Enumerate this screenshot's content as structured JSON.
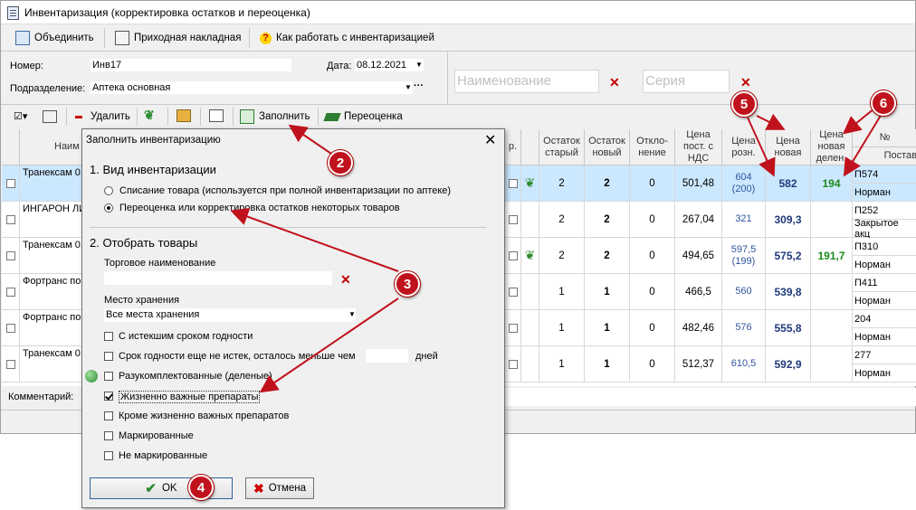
{
  "window": {
    "title": "Инвентаризация (корректировка остатков и переоценка)"
  },
  "toolbar": {
    "merge": "Объединить",
    "incoming": "Приходная накладная",
    "howto": "Как работать с инвентаризацией"
  },
  "header": {
    "number_label": "Номер:",
    "number_value": "Инв17",
    "date_label": "Дата:",
    "date_value": "08.12.2021",
    "dept_label": "Подразделение:",
    "dept_value": "Аптека основная",
    "name_placeholder": "Наименование",
    "series_placeholder": "Серия"
  },
  "toolbar2": {
    "delete": "Удалить",
    "fill": "Заполнить",
    "reprice": "Переоценка"
  },
  "grid": {
    "columns": {
      "name": "Наим",
      "pr": "р.",
      "old_stock": "Остаток старый",
      "new_stock": "Остаток новый",
      "deviation": "Откло-нение",
      "price_vat": "Цена пост. с НДС",
      "price_retail": "Цена розн.",
      "price_new": "Цена новая",
      "price_new_div": "Цена новая делен.",
      "no": "№",
      "supplier": "Постав"
    },
    "rows": [
      {
        "name": "Транексам 0,",
        "old": "2",
        "new": "2",
        "dev": "0",
        "vat": "501,48",
        "retail": "604",
        "retail2": "(200)",
        "pnew": "582",
        "pdiv": "194",
        "no": "П574",
        "sup": "Норман"
      },
      {
        "name": "ИНГАРОН ЛИ Р-РА ДЛЯ ИН ВВЕД. 100ТЫ",
        "old": "2",
        "new": "2",
        "dev": "0",
        "vat": "267,04",
        "retail": "321",
        "retail2": "",
        "pnew": "309,3",
        "pdiv": "",
        "no": "П252",
        "sup": "Закрытое акц"
      },
      {
        "name": "Транексам 0,",
        "old": "2",
        "new": "2",
        "dev": "0",
        "vat": "494,65",
        "retail": "597,5",
        "retail2": "(199)",
        "pnew": "575,2",
        "pdiv": "191,7",
        "no": "П310",
        "sup": "Норман"
      },
      {
        "name": "Фортранс пор пак.№4*",
        "old": "1",
        "new": "1",
        "dev": "0",
        "vat": "466,5",
        "retail": "560",
        "retail2": "",
        "pnew": "539,8",
        "pdiv": "",
        "no": "П411",
        "sup": "Норман"
      },
      {
        "name": "Фортранс пор пак.№4*",
        "old": "1",
        "new": "1",
        "dev": "0",
        "vat": "482,46",
        "retail": "576",
        "retail2": "",
        "pnew": "555,8",
        "pdiv": "",
        "no": "204",
        "sup": "Норман"
      },
      {
        "name": "Транексам 0,",
        "old": "1",
        "new": "1",
        "dev": "0",
        "vat": "512,37",
        "retail": "610,5",
        "retail2": "",
        "pnew": "592,9",
        "pdiv": "",
        "no": "277",
        "sup": "Норман"
      }
    ]
  },
  "comment_label": "Комментарий:",
  "dialog": {
    "title": "Заполнить инвентаризацию",
    "section1": "1. Вид инвентаризации",
    "radio1": "Списание товара (используется при полной инвентаризации по аптеке)",
    "radio2": "Переоценка или корректировка остатков некоторых товаров",
    "section2": "2. Отобрать товары",
    "trade_label": "Торговое наименование",
    "storage_label": "Место хранения",
    "storage_value": "Все места хранения",
    "opt_expired": "С истекшим сроком годности",
    "opt_not_expired": "Срок годности еще не истек, осталось меньше чем",
    "opt_days": "дней",
    "opt_split": "Разукомплектованные (деленые)",
    "opt_vital": "Жизненно важные препараты",
    "opt_not_vital": "Кроме жизненно важных препаратов",
    "opt_marked": "Маркированные",
    "opt_not_marked": "Не маркированные",
    "ok": "OK",
    "cancel": "Отмена"
  },
  "badges": [
    "2",
    "3",
    "4",
    "5",
    "6"
  ],
  "colors": {
    "annotation": "#c0121d",
    "selected_row": "#cce8ff",
    "price_new": "#1f3a7a",
    "price_div": "#1a8a1a"
  }
}
